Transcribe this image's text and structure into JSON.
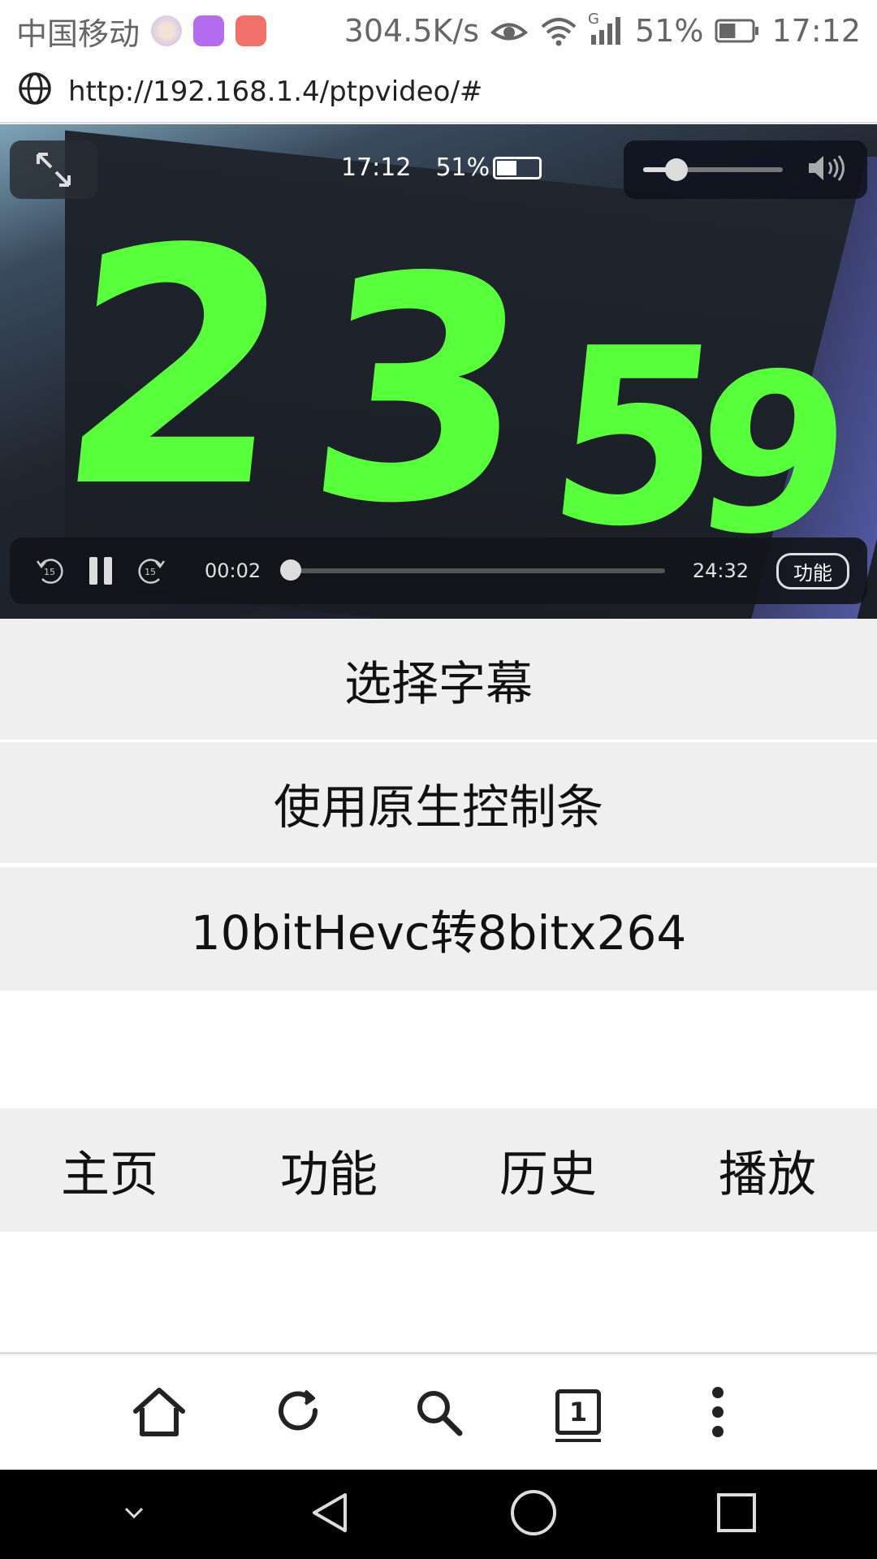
{
  "status_bar": {
    "carrier": "中国移动",
    "net_speed": "304.5K/s",
    "network_type": "G",
    "battery_percent": "51%",
    "battery_level": 0.51,
    "time": "17:12",
    "icons": [
      "notif-avatar-icon",
      "gallery-app-icon",
      "tool-app-icon",
      "eye-icon",
      "wifi-icon",
      "signal-icon",
      "battery-icon"
    ]
  },
  "url_bar": {
    "url": "http://192.168.1.4/ptpvideo/#",
    "icon": "globe-icon"
  },
  "video": {
    "scene_digits": [
      "2",
      "3",
      "5",
      "9"
    ],
    "overlay_time": "17:12",
    "overlay_battery": "51%",
    "volume_level": 0.24,
    "current_time": "00:02",
    "duration": "24:32",
    "progress": 0.001,
    "function_label": "功能",
    "colors": {
      "digit_green": "#58ff3b",
      "controls_bg": "#121418"
    }
  },
  "options": [
    {
      "label": "选择字幕"
    },
    {
      "label": "使用原生控制条"
    },
    {
      "label": "10bitHevc转8bitx264"
    }
  ],
  "nav_tabs": [
    {
      "label": "主页"
    },
    {
      "label": "功能"
    },
    {
      "label": "历史"
    },
    {
      "label": "播放"
    }
  ],
  "browser_toolbar": {
    "tab_count": "1",
    "icons": [
      "home-icon",
      "refresh-icon",
      "search-icon",
      "tabs-icon",
      "more-icon"
    ]
  },
  "system_nav": {
    "icons": [
      "collapse-icon",
      "back-icon",
      "home-circle-icon",
      "recents-icon"
    ]
  }
}
